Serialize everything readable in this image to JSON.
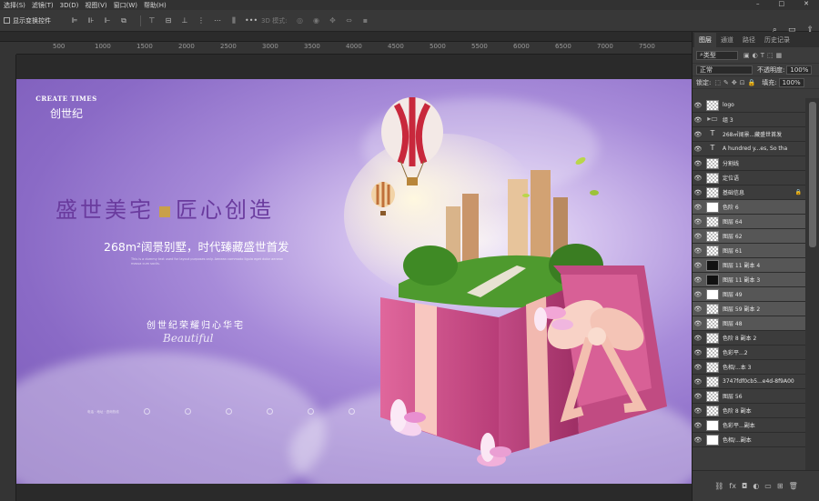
{
  "menu": [
    "选择(S)",
    "滤镜(T)",
    "3D(D)",
    "视图(V)",
    "窗口(W)",
    "帮助(H)"
  ],
  "options": {
    "show_transform": "显示变换控件",
    "mode3d": "3D 模式:"
  },
  "ruler_ticks": [
    "500",
    "1000",
    "1500",
    "2000",
    "2500",
    "3000",
    "3500",
    "4000",
    "4500",
    "5000",
    "5500",
    "6000",
    "6500",
    "7000",
    "7500"
  ],
  "poster": {
    "logo_en": "CREATE TIMES",
    "logo_cn": "创世纪",
    "headline_left": "盛世美宅",
    "headline_right": "匠心创造",
    "subline": "268m²阔景别墅，时代臻藏盛世首发",
    "small_text": "This is a dummy text used for layout purposes only. Aenean commodo ligula eget dolor aenean massa cum sociis.",
    "slogan": "创世纪荣耀归心华宅",
    "script": "Beautiful",
    "contact": "电话 · 地址 · 咨询热线"
  },
  "panel": {
    "tabs": [
      "图层",
      "通道",
      "路径",
      "历史记录"
    ],
    "filter": "类型",
    "blend": "正常",
    "opacity_label": "不透明度:",
    "opacity": "100%",
    "lock_label": "锁定:",
    "fill_label": "填充:",
    "fill": "100%",
    "layers": [
      {
        "name": "logo",
        "thumb": "checker"
      },
      {
        "name": "组 3",
        "thumb": "folder"
      },
      {
        "name": "268㎡阔景...藏盛世首发",
        "thumb": "text"
      },
      {
        "name": "A hundred y...es, So tha",
        "thumb": "text"
      },
      {
        "name": "分割线",
        "thumb": "checker"
      },
      {
        "name": "定位语",
        "thumb": "checker"
      },
      {
        "name": "基础信息",
        "thumb": "checker",
        "lock": true
      },
      {
        "name": "色阶 6",
        "thumb": "white",
        "hl": true
      },
      {
        "name": "图层 64",
        "thumb": "checker",
        "hl": true
      },
      {
        "name": "图层 62",
        "thumb": "checker",
        "hl": true
      },
      {
        "name": "图层 61",
        "thumb": "checker",
        "hl": true
      },
      {
        "name": "图层 11 副本 4",
        "thumb": "black",
        "hl": true
      },
      {
        "name": "图层 11 副本 3",
        "thumb": "black",
        "hl": true
      },
      {
        "name": "图层 49",
        "thumb": "white",
        "hl": true
      },
      {
        "name": "图层 59 副本 2",
        "thumb": "checker",
        "hl": true
      },
      {
        "name": "图层 48",
        "thumb": "checker",
        "hl": true
      },
      {
        "name": "色阶 8 副本 2",
        "thumb": "checker"
      },
      {
        "name": "色彩平...2",
        "thumb": "checker"
      },
      {
        "name": "色相/...本 3",
        "thumb": "checker"
      },
      {
        "name": "3747fdf0cb5...e4d-8f9A00",
        "thumb": "checker"
      },
      {
        "name": "图层 56",
        "thumb": "checker"
      },
      {
        "name": "色阶 8 副本",
        "thumb": "checker"
      },
      {
        "name": "色彩平...副本",
        "thumb": "white"
      },
      {
        "name": "色相/...副本",
        "thumb": "white"
      }
    ]
  }
}
